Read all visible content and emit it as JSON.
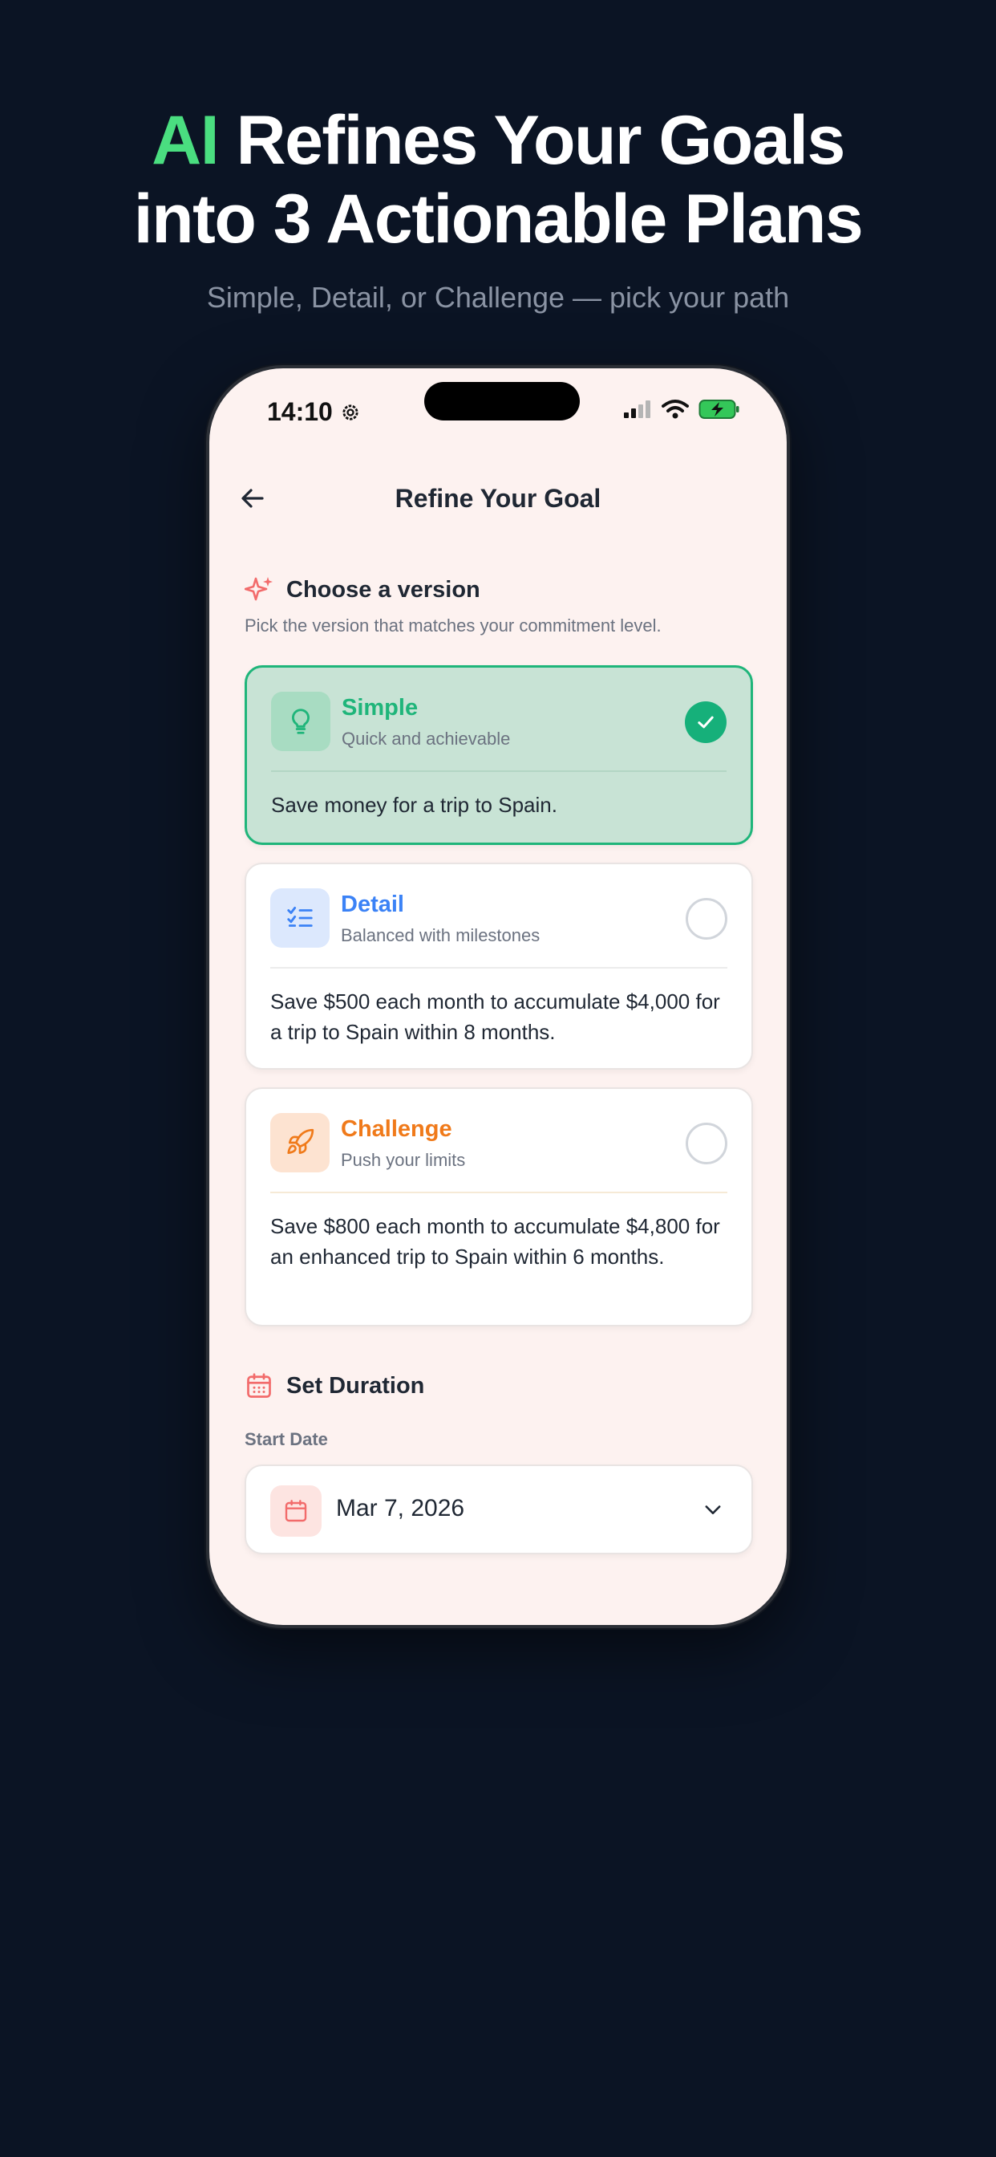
{
  "hero": {
    "headline_accent": "AI",
    "headline_line1_rest": "Refines Your Goals",
    "headline_line2": "into 3 Actionable Plans",
    "subhead": "Simple, Detail, or Challenge — pick your path"
  },
  "status_bar": {
    "time": "14:10",
    "icons": [
      "settings-gear-icon",
      "signal-bars-icon",
      "wifi-icon",
      "battery-charging-icon"
    ]
  },
  "nav": {
    "back_icon": "arrow-left-icon",
    "title": "Refine Your Goal"
  },
  "version_section": {
    "icon": "sparkles-icon",
    "title": "Choose a version",
    "subtitle": "Pick the version that matches your commitment level.",
    "options": [
      {
        "title": "Simple",
        "subtitle": "Quick and achievable",
        "body": "Save money for a trip to Spain.",
        "icon": "lightbulb-icon",
        "selected": true,
        "accent": "#1fb57a"
      },
      {
        "title": "Detail",
        "subtitle": "Balanced with milestones",
        "body": "Save $500 each month to accumulate $4,000 for a trip to Spain within 8 months.",
        "icon": "checklist-icon",
        "selected": false,
        "accent": "#3b82f6"
      },
      {
        "title": "Challenge",
        "subtitle": "Push your limits",
        "body": "Save $800 each month to accumulate $4,800 for an enhanced trip to Spain within 6 months.",
        "icon": "rocket-icon",
        "selected": false,
        "accent": "#f07a1a"
      }
    ]
  },
  "duration_section": {
    "icon": "calendar-icon",
    "title": "Set Duration",
    "start_date_label": "Start Date",
    "start_date_value": "Mar 7, 2026",
    "dropdown_icon": "chevron-down-icon"
  },
  "colors": {
    "background": "#0b1424",
    "accent_green": "#4ade80",
    "phone_screen": "#fdf2f0",
    "selected_card": "#c8e3d5",
    "coral": "#f26b6b"
  }
}
